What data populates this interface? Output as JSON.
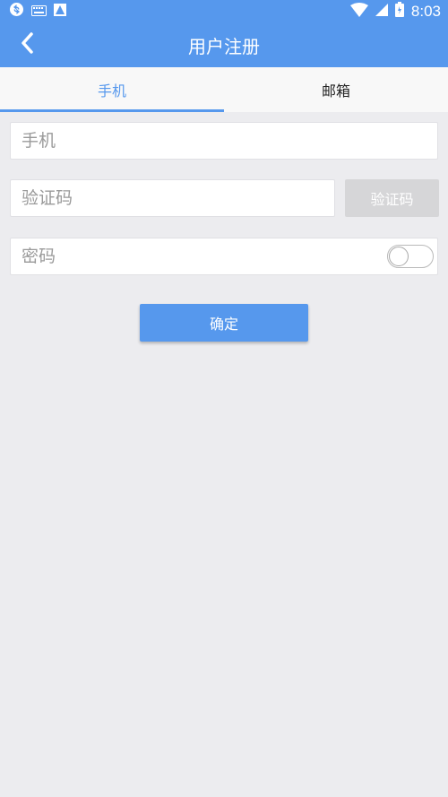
{
  "status_bar": {
    "time": "8:03",
    "icons": [
      "sync-icon",
      "keyboard-icon",
      "image-icon",
      "wifi-icon",
      "signal-icon",
      "battery-icon"
    ]
  },
  "app_bar": {
    "title": "用户注册",
    "back_icon": "chevron-left-icon"
  },
  "tabs": [
    {
      "label": "手机",
      "active": true
    },
    {
      "label": "邮箱",
      "active": false
    }
  ],
  "form": {
    "phone": {
      "placeholder": "手机",
      "value": ""
    },
    "code": {
      "placeholder": "验证码",
      "value": ""
    },
    "code_button": "验证码",
    "password": {
      "placeholder": "密码",
      "value": "",
      "show_toggle_on": false
    },
    "confirm_button": "确定"
  },
  "colors": {
    "primary": "#5698ed",
    "background": "#ececef",
    "disabled": "#d6d6d8"
  }
}
